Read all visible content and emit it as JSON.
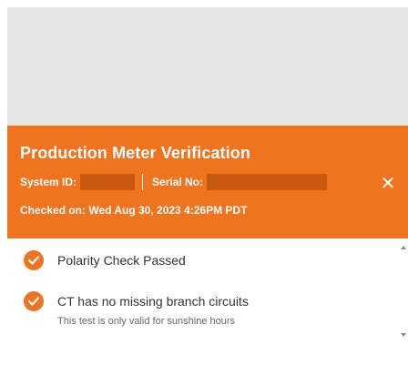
{
  "modal": {
    "title": "Production Meter Verification",
    "system_id_label": "System ID:",
    "serial_no_label": "Serial No:",
    "checked_on": "Checked on: Wed Aug 30, 2023 4:26PM PDT",
    "close_glyph": "✕"
  },
  "checks": [
    {
      "label": "Polarity Check Passed",
      "icon": "checkmark-icon"
    },
    {
      "label": "CT has no missing branch circuits",
      "note": "This test is only valid for sunshine hours",
      "icon": "checkmark-icon"
    }
  ],
  "colors": {
    "header_bg": "#f07320",
    "redaction": "#c85a10",
    "backdrop": "#e6e6e6",
    "text_primary": "#333333",
    "text_secondary": "#666666"
  }
}
